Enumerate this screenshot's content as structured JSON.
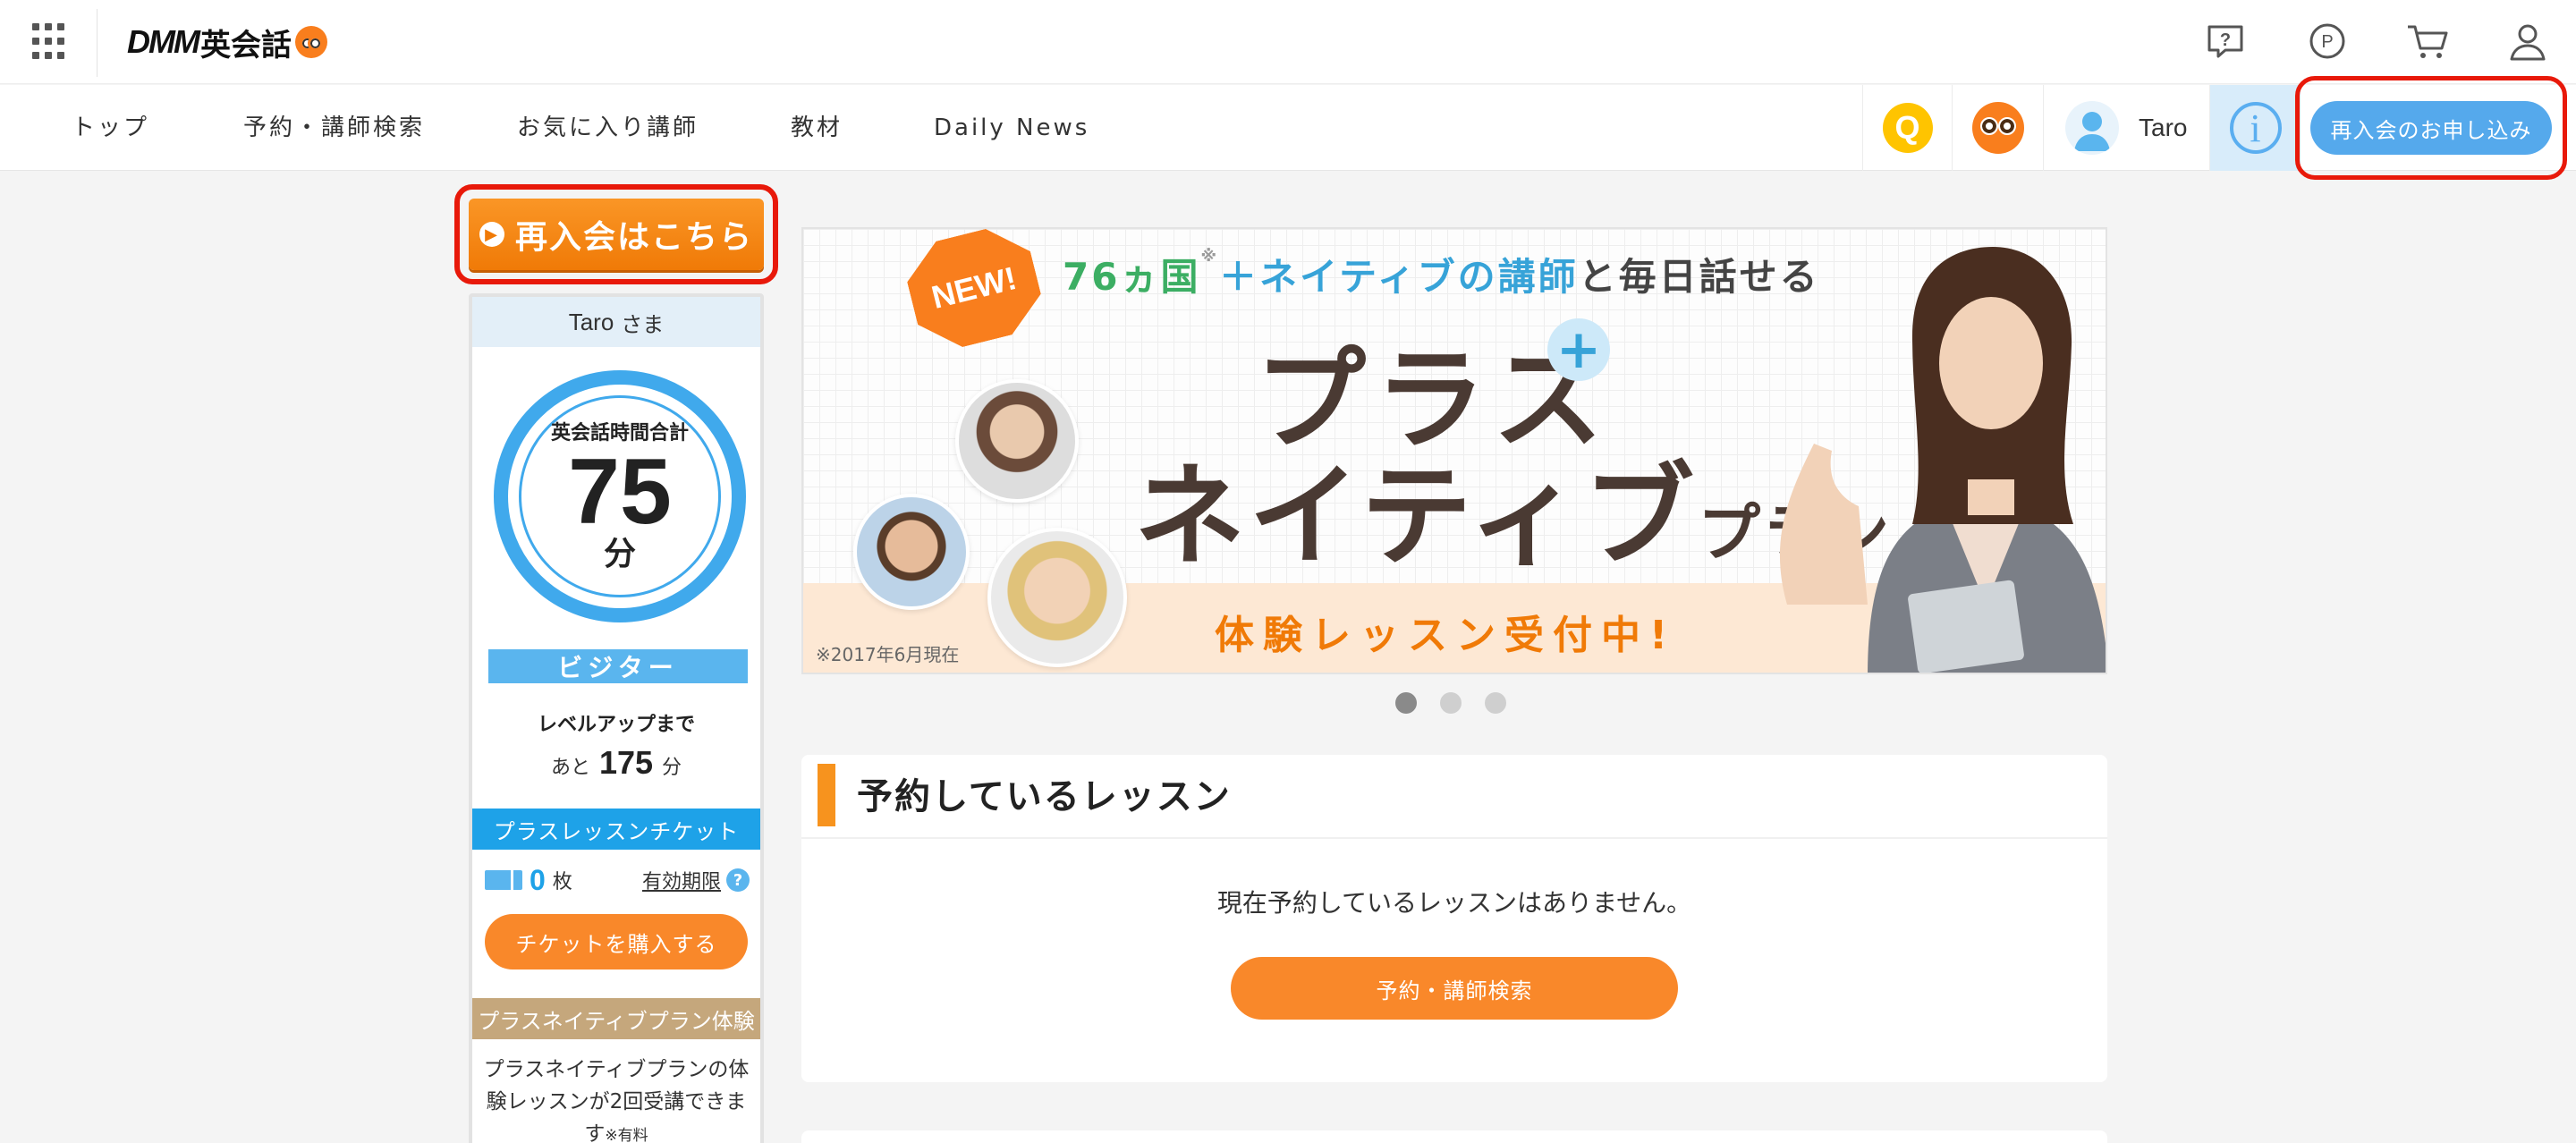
{
  "header": {
    "logo_text": "DMM",
    "logo_suffix": "英会話",
    "icons": [
      "help-icon",
      "points-icon",
      "cart-icon",
      "account-icon"
    ]
  },
  "nav": {
    "items": [
      "トップ",
      "予約・講師検索",
      "お気に入り講師",
      "教材",
      "Daily News"
    ],
    "q_label": "Q",
    "user_name": "Taro",
    "info_label": "i",
    "rejoin_button": "再入会のお申し込み"
  },
  "sidebar": {
    "rejoin_button": "再入会はこちら",
    "user_name": "Taro",
    "honorific": "さま",
    "total_label": "英会話時間合計",
    "total_minutes": "75",
    "minutes_unit": "分",
    "rank": "ビジター",
    "levelup_label": "レベルアップまで",
    "remain_prefix": "あと",
    "remain_minutes": "175",
    "remain_unit": "分",
    "ticket_header": "プラスレッスンチケット",
    "ticket_count": "0",
    "ticket_unit": "枚",
    "expiry_link": "有効期限",
    "help_label": "?",
    "buy_button": "チケットを購入する",
    "plus_header": "プラスネイティブプラン体験",
    "plus_body": "プラスネイティブプランの体験レッスンが2回受講できます",
    "plus_note": "※有料"
  },
  "banner": {
    "new_badge": "NEW!",
    "top_green": "76ヵ国",
    "top_mark": "※",
    "top_plus": "＋",
    "top_blue": "ネイティブの講師",
    "top_rest": "と毎日話せる",
    "title_line1": "プラス",
    "title_line2": "ネイティブ",
    "title_line2_small": "プラン",
    "plus_symbol": "+",
    "cta": "体験レッスン受付中!",
    "note": "※2017年6月現在",
    "dots": 3,
    "active_dot": 1
  },
  "lessons": {
    "title": "予約しているレッスン",
    "empty_text": "現在予約しているレッスンはありません。",
    "search_button": "予約・講師検索"
  }
}
